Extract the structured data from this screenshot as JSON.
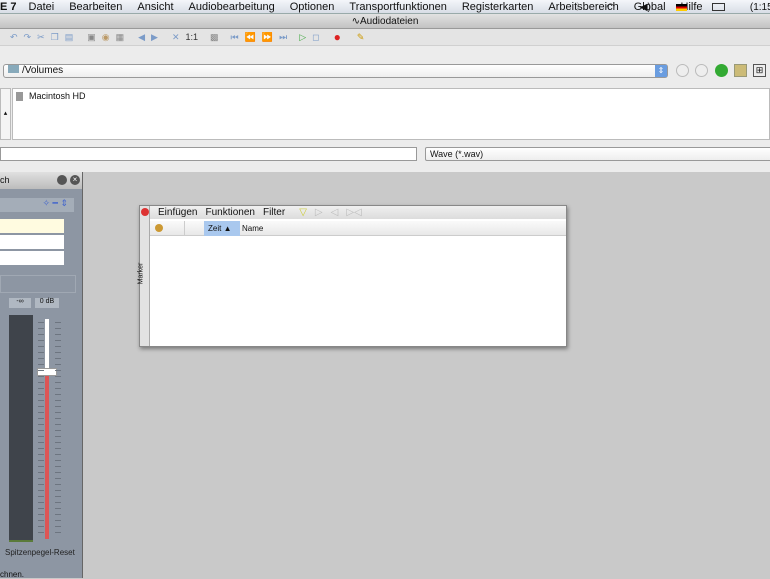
{
  "menubar": {
    "app": "E 7",
    "items": [
      "Datei",
      "Bearbeiten",
      "Ansicht",
      "Audiobearbeitung",
      "Optionen",
      "Transportfunktionen",
      "Registerkarten",
      "Arbeitsbereich",
      "Global",
      "Hilfe"
    ],
    "clock": "(1:15)"
  },
  "window": {
    "title": "Audiodateien"
  },
  "toolbar": {
    "zoom_label": "1:1"
  },
  "browser": {
    "path": "/Volumes",
    "items": [
      "Macintosh HD"
    ],
    "filename_value": "",
    "filetype": "Wave (*.wav)"
  },
  "leftpanel": {
    "title": "ch",
    "meter_labels": [
      "-∞",
      "0 dB"
    ],
    "reset_label": "Spitzenpegel-Reset",
    "bottom_text": "chnen."
  },
  "marker": {
    "side_label": "Marker",
    "menu": [
      "Einfügen",
      "Funktionen",
      "Filter"
    ],
    "columns": [
      "Zeit",
      "Name"
    ]
  }
}
